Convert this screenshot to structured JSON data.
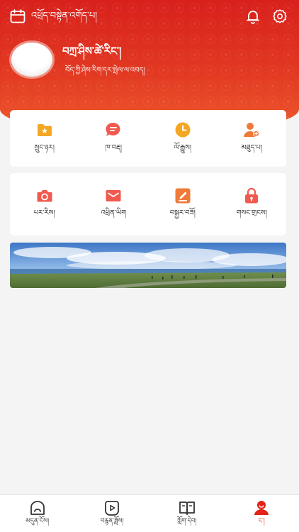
{
  "header": {
    "app_title": "འཕྲོད་བསྟེན་འགོད་པ།",
    "user_name": "བཀྲ་ཤིས་ཚེ་རིང་།",
    "user_motto": "བོད་ཀྱི་ཤེས་རིག་དར་སྤེལ་ལ་འབད།",
    "icons": {
      "calendar": "calendar-icon",
      "bell": "bell-icon",
      "settings": "gear-icon"
    }
  },
  "menu_row1": [
    {
      "icon": "folder-star-icon",
      "label": "སྲུང་ཉར།",
      "color": "#f5a623"
    },
    {
      "icon": "message-icon",
      "label": "ཁ་བརྡ།",
      "color": "#f05a4f"
    },
    {
      "icon": "clock-icon",
      "label": "ལོ་རྒྱུས།",
      "color": "#f5a623"
    },
    {
      "icon": "user-add-icon",
      "label": "མཐུད་པ།",
      "color": "#f07a3a"
    }
  ],
  "menu_row2": [
    {
      "icon": "camera-icon",
      "label": "པར་རིས།",
      "color": "#f05a4f"
    },
    {
      "icon": "mail-icon",
      "label": "འཕྲིན་ཡིག",
      "color": "#f05a4f"
    },
    {
      "icon": "edit-icon",
      "label": "བསྐྱར་བཟོ།",
      "color": "#f07a3a"
    },
    {
      "icon": "lock-icon",
      "label": "གསང་གྲངས།",
      "color": "#f05a4f"
    }
  ],
  "banner": {
    "image": "grassland-lake-panorama"
  },
  "tabbar": [
    {
      "icon": "home-icon",
      "label": "མདུན་ངོས།",
      "active": false
    },
    {
      "icon": "play-icon",
      "label": "བརྙན་ཟློས།",
      "active": false
    },
    {
      "icon": "book-icon",
      "label": "ཀློག་དེབ།",
      "active": false
    },
    {
      "icon": "profile-icon",
      "label": "ང་།",
      "active": true
    }
  ],
  "colors": {
    "accent": "#e2231a",
    "header_top": "#d8201c",
    "header_bottom": "#ef5a2e"
  }
}
